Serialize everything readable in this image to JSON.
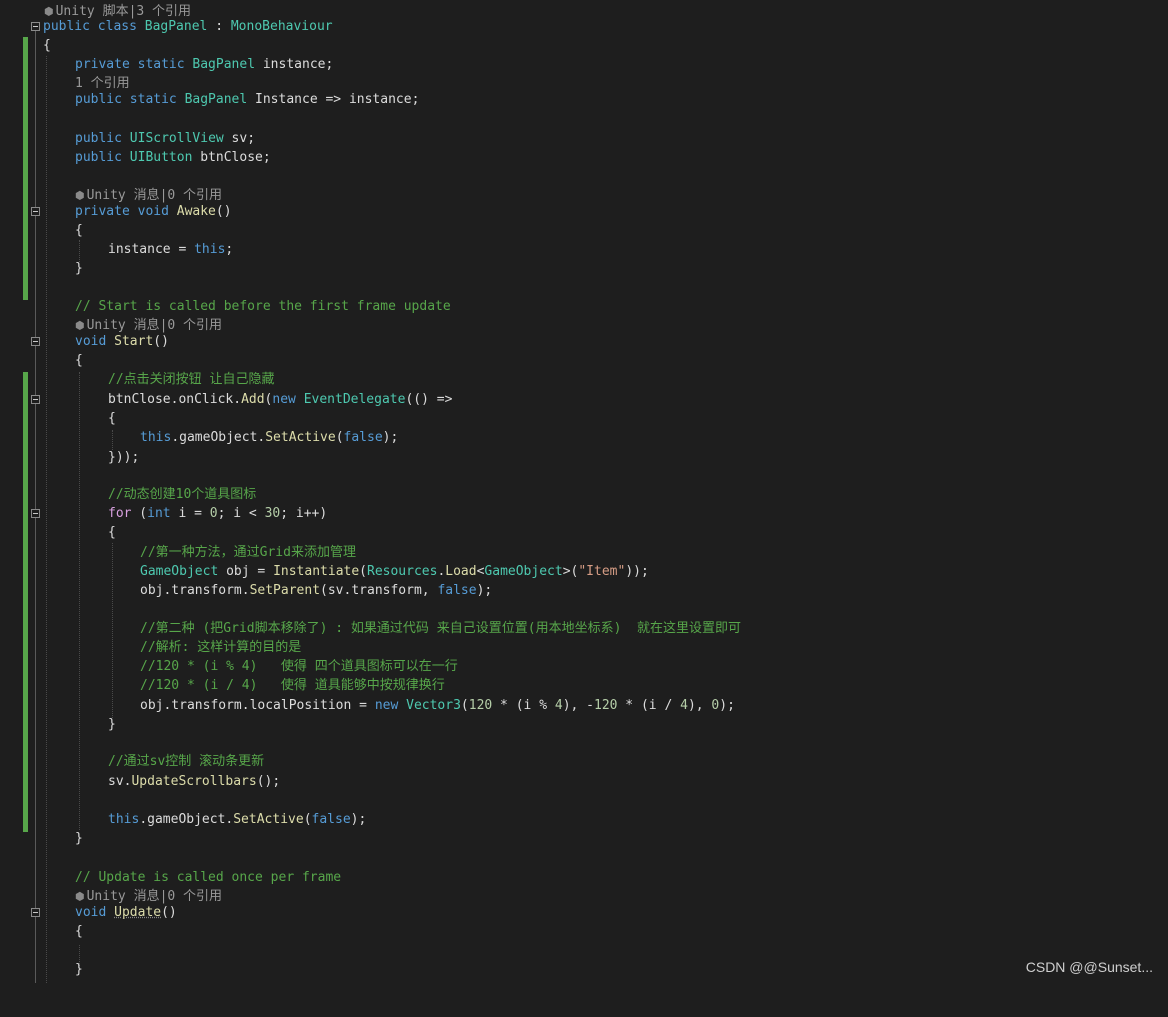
{
  "lenses": {
    "class": "Unity 脚本|3 个引用",
    "instance_prop": "1 个引用",
    "awake": "Unity 消息|0 个引用",
    "start": "Unity 消息|0 个引用",
    "update": "Unity 消息|0 个引用"
  },
  "code": {
    "class_decl_kw": "public class",
    "class_name": "BagPanel",
    "class_colon": " : ",
    "base_class": "MonoBehaviour",
    "open_brace": "{",
    "close_brace": "}",
    "private_static": "private static",
    "public_static": "public static",
    "public_kw": "public",
    "private_void": "private void",
    "void_kw": "void",
    "field_instance": "instance;",
    "prop_instance": "Instance => instance;",
    "uiscrollview": "UIScrollView",
    "sv_decl": "sv;",
    "uibutton": "UIButton",
    "btnclose_decl": "btnClose;",
    "awake_name": "Awake",
    "parens": "()",
    "awake_body_lhs": "instance = ",
    "this_kw": "this",
    "semi": ";",
    "start_comment": "// Start is called before the first frame update",
    "start_name": "Start",
    "cm_close_btn": "//点击关闭按钮 让自己隐藏",
    "btnclose_onclick": "btnClose.onClick.",
    "add_fn": "Add",
    "paren_open": "(",
    "new_kw": "new",
    "event_delegate": "EventDelegate",
    "lambda": "(() =>",
    "dot_gameobject": ".gameObject.",
    "setactive": "SetActive",
    "false_kw": "false",
    "close_paren_semi": ");",
    "close_lambda": "}));",
    "cm_create_items": "//动态创建10个道具图标",
    "for_kw": "for",
    "for_open": " (",
    "int_kw": "int",
    "for_cond_1": " i = ",
    "num_0": "0",
    "for_cond_2": "; i < ",
    "num_30": "30",
    "for_cond_3": "; i++)",
    "cm_method1": "//第一种方法，通过Grid来添加管理",
    "gameobject_type": "GameObject",
    "obj_assign": " obj = ",
    "instantiate": "Instantiate",
    "resources": "Resources",
    "dot": ".",
    "load": "Load",
    "lt": "<",
    "gt": ">",
    "item_str": "\"Item\"",
    "close2": "));",
    "obj_transform": "obj.transform.",
    "setparent": "SetParent",
    "sv_transform": "(sv.transform, ",
    "cm_method2": "//第二种 (把Grid脚本移除了) : 如果通过代码 来自己设置位置(用本地坐标系)  就在这里设置即可",
    "cm_analysis": "//解析: 这样计算的目的是",
    "cm_mod": "//120 * (i % 4)   使得 四个道具图标可以在一行",
    "cm_div": "//120 * (i / 4)   使得 道具能够中按规律换行",
    "local_pos": "obj.transform.localPosition = ",
    "vector3": "Vector3",
    "vec_args_1": "(",
    "num_120": "120",
    "vec_args_2": " * (i % ",
    "num_4": "4",
    "vec_args_3": "), -",
    "vec_args_4": " * (i / ",
    "vec_args_5": "), ",
    "vec_args_6": ");",
    "cm_sv_update": "//通过sv控制 滚动条更新",
    "sv_dot": "sv.",
    "update_scrollbars": "UpdateScrollbars",
    "call_end": "();",
    "this_gameobject_setactive_end": "(false);",
    "update_comment": "// Update is called once per frame",
    "update_name": "Update"
  },
  "watermark": "CSDN @@Sunset...",
  "colors": {
    "background": "#1e1e1e",
    "keyword": "#569cd6",
    "type": "#4ec9b0",
    "comment": "#57a64a",
    "method": "#dcdcaa",
    "string": "#d69d85",
    "number": "#b5cea8",
    "control": "#d8a0df",
    "text": "#dcdcdc",
    "gutter_changed": "#57a64a"
  },
  "icons": {
    "codelens": "unity-cube-icon",
    "fold": "collapse-minus-icon"
  }
}
